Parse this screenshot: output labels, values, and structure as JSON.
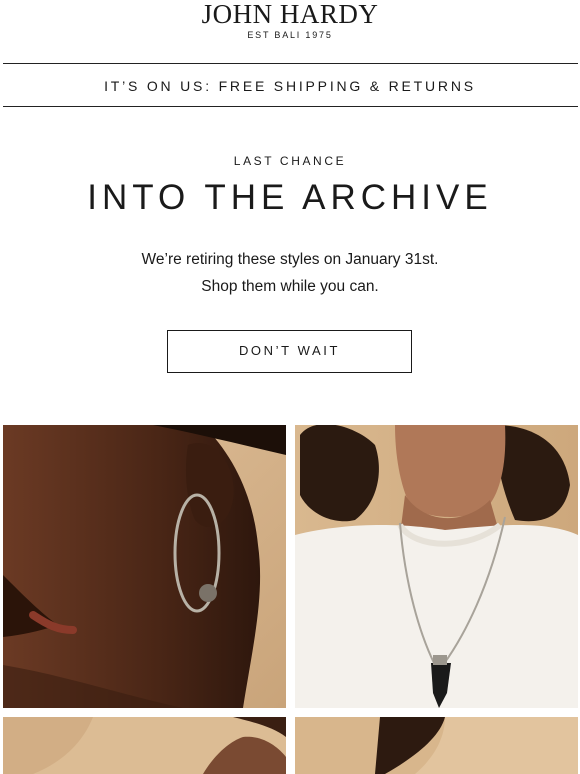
{
  "header": {
    "brand": "JOHN HARDY",
    "tagline": "EST BALI 1975"
  },
  "promo": {
    "text": "IT’S ON US: FREE SHIPPING & RETURNS"
  },
  "hero": {
    "eyebrow": "LAST CHANCE",
    "headline": "INTO THE ARCHIVE",
    "body_line1": "We’re retiring these styles on January 31st.",
    "body_line2": "Shop them while you can.",
    "cta_label": "DON’T WAIT"
  },
  "images": {
    "tile1": "woman-hoop-earring-photo",
    "tile2": "man-pendant-necklace-photo",
    "tile3": "product-photo-bottom-left",
    "tile4": "product-photo-bottom-right"
  },
  "colors": {
    "text": "#1a1a1a",
    "background": "#ffffff",
    "photo_bg": "#d8b890"
  }
}
